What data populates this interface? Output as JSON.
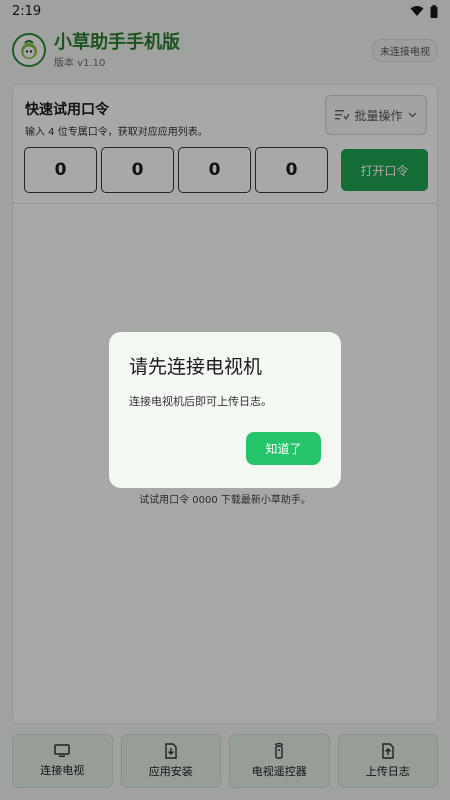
{
  "status_bar": {
    "time": "2:19"
  },
  "header": {
    "title": "小草助手手机版",
    "version": "版本 v1.10",
    "tv_status": "未连接电视"
  },
  "card": {
    "title": "快速试用口令",
    "description": "输入 4 位专属口令，获取对应应用列表。",
    "batch_label": "批量操作",
    "code_digits": [
      "0",
      "0",
      "0",
      "0"
    ],
    "open_label": "打开口令",
    "hint": "试试用口令 0000 下载最新小草助手。"
  },
  "bottom_bar": {
    "items": [
      {
        "label": "连接电视",
        "icon": "tv-icon"
      },
      {
        "label": "应用安装",
        "icon": "install-icon"
      },
      {
        "label": "电视遥控器",
        "icon": "remote-icon"
      },
      {
        "label": "上传日志",
        "icon": "upload-log-icon"
      }
    ]
  },
  "dialog": {
    "title": "请先连接电视机",
    "message": "连接电视机后即可上传日志。",
    "confirm_label": "知道了"
  },
  "colors": {
    "brand_green": "#2e7d32",
    "button_green": "#1fa652",
    "dialog_button": "#25c46a"
  }
}
